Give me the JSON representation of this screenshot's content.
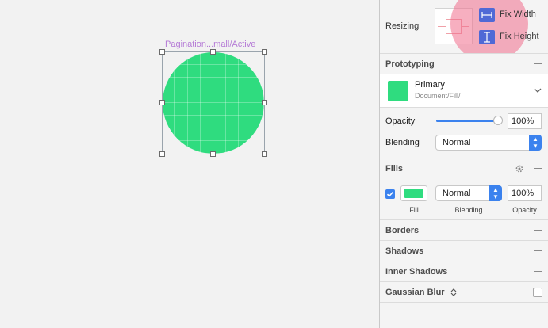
{
  "canvas": {
    "layer_label": "Pagination...mall/Active",
    "shape_color": "#2fdc7f",
    "selection_color": "#9aa4ad"
  },
  "inspector": {
    "resizing": {
      "label": "Resizing",
      "fix_width_label": "Fix Width",
      "fix_height_label": "Fix Height",
      "fix_width_icon": "fix-width-icon",
      "fix_height_icon": "fix-height-icon",
      "highlight_color": "#f06e8c"
    },
    "prototyping": {
      "label": "Prototyping",
      "style_name": "Primary",
      "style_path": "Document/Fill/",
      "swatch_color": "#2fdc7f"
    },
    "opacity": {
      "label": "Opacity",
      "value": "100%",
      "slider_fraction": 1.0
    },
    "blending": {
      "label": "Blending",
      "value": "Normal"
    },
    "fills": {
      "label": "Fills",
      "checked": true,
      "color": "#2fdc7f",
      "blend_value": "Normal",
      "opacity_value": "100%",
      "fill_caption": "Fill",
      "blending_caption": "Blending",
      "opacity_caption": "Opacity"
    },
    "sections": {
      "borders": "Borders",
      "shadows": "Shadows",
      "inner_shadows": "Inner Shadows",
      "gaussian_blur": "Gaussian Blur"
    },
    "accent_color": "#3b82ee"
  }
}
